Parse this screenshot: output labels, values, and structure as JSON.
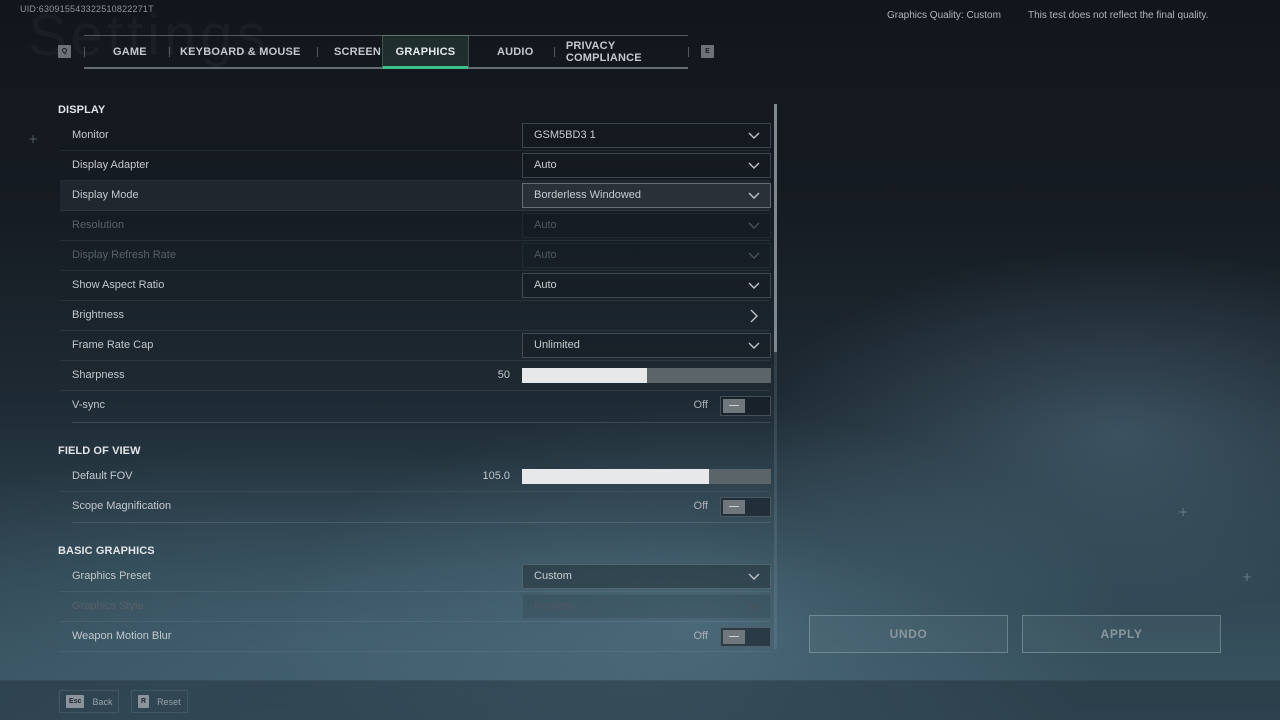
{
  "watermark": "Settings",
  "uid": "UID:630915543322510822271T",
  "top_info": {
    "graphics_quality": "Graphics Quality: Custom",
    "disclaimer": "This test does not reflect the final quality."
  },
  "tabbar": {
    "left_key": "Q",
    "right_key": "E",
    "active_index": 3,
    "tabs": [
      {
        "label": "GAME"
      },
      {
        "label": "KEYBOARD & MOUSE"
      },
      {
        "label": "SCREEN"
      },
      {
        "label": "GRAPHICS"
      },
      {
        "label": "AUDIO"
      },
      {
        "label": "PRIVACY COMPLIANCE"
      }
    ]
  },
  "sections": {
    "display": {
      "title": "DISPLAY",
      "monitor": {
        "label": "Monitor",
        "value": "GSM5BD3 1"
      },
      "display_adapter": {
        "label": "Display Adapter",
        "value": "Auto"
      },
      "display_mode": {
        "label": "Display Mode",
        "value": "Borderless Windowed"
      },
      "resolution": {
        "label": "Resolution",
        "value": "Auto",
        "disabled": true
      },
      "refresh_rate": {
        "label": "Display Refresh Rate",
        "value": "Auto",
        "disabled": true
      },
      "aspect_ratio": {
        "label": "Show Aspect Ratio",
        "value": "Auto"
      },
      "brightness": {
        "label": "Brightness"
      },
      "frame_rate_cap": {
        "label": "Frame Rate Cap",
        "value": "Unlimited"
      },
      "sharpness": {
        "label": "Sharpness",
        "value": "50",
        "fill_percent": 50
      },
      "vsync": {
        "label": "V-sync",
        "state": "Off"
      }
    },
    "fov": {
      "title": "FIELD OF VIEW",
      "default_fov": {
        "label": "Default FOV",
        "value": "105.0",
        "fill_percent": 75
      },
      "scope_magnification": {
        "label": "Scope Magnification",
        "state": "Off"
      }
    },
    "basic_graphics": {
      "title": "BASIC GRAPHICS",
      "graphics_preset": {
        "label": "Graphics Preset",
        "value": "Custom"
      },
      "graphics_style": {
        "label": "Graphics Style",
        "value": "Realistic",
        "disabled": true
      },
      "weapon_motion_blur": {
        "label": "Weapon Motion Blur",
        "state": "Off"
      }
    }
  },
  "actions": {
    "undo": "UNDO",
    "apply": "APPLY"
  },
  "footer": {
    "back": {
      "key": "Esc",
      "label": "Back"
    },
    "reset": {
      "key": "R",
      "label": "Reset"
    }
  }
}
